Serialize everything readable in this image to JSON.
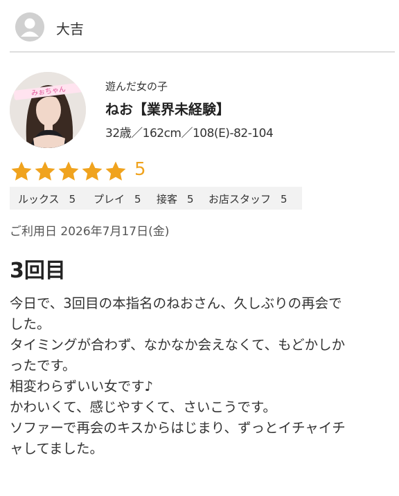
{
  "reviewer": {
    "name": "大吉",
    "icon": "user-avatar-icon"
  },
  "girl": {
    "caption": "遊んだ女の子",
    "name": "ねお【業界未経験】",
    "stats": "32歳／162cm／108(E)-82-104",
    "photo_banner": "みぉちゃん"
  },
  "rating": {
    "stars": 5,
    "overall": "5",
    "star_color": "#f0a31e",
    "categories": [
      {
        "label": "ルックス",
        "score": "5"
      },
      {
        "label": "プレイ",
        "score": "5"
      },
      {
        "label": "接客",
        "score": "5"
      },
      {
        "label": "お店スタッフ",
        "score": "5"
      }
    ]
  },
  "visit_date": "ご利用日 2026年7月17日(金)",
  "review": {
    "title": "3回目",
    "lines": [
      "今日で、3回目の本指名のねおさん、久しぶりの再会で",
      "した。",
      "タイミングが合わず、なかなか会えなくて、もどかしか",
      "ったです。",
      "相変わらずいい女です♪",
      "かわいくて、感じやすくて、さいこうです。",
      "ソファーで再会のキスからはじまり、ずっとイチャイチ",
      "ャしてました。"
    ]
  }
}
